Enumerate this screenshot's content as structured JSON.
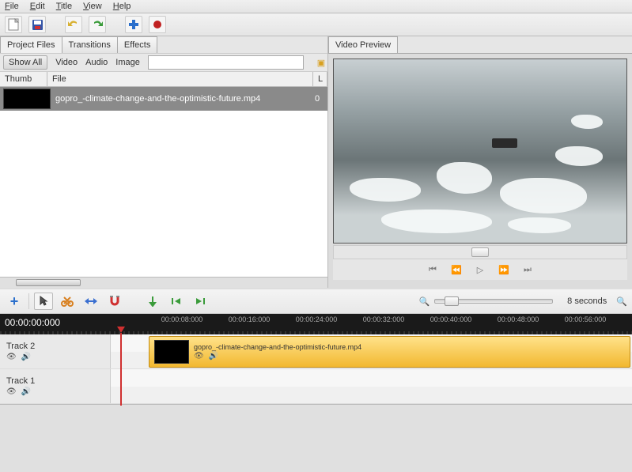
{
  "menu": {
    "file": "File",
    "edit": "Edit",
    "title": "Title",
    "view": "View",
    "help": "Help"
  },
  "toolbar_icons": {
    "new": "new",
    "save": "save",
    "undo": "undo",
    "redo": "redo",
    "add": "add",
    "record": "record"
  },
  "left_tabs": {
    "project_files": "Project Files",
    "transitions": "Transitions",
    "effects": "Effects"
  },
  "filter": {
    "show_all": "Show All",
    "video": "Video",
    "audio": "Audio",
    "image": "Image"
  },
  "file_headers": {
    "thumb": "Thumb",
    "file": "File",
    "length": "L"
  },
  "files": [
    {
      "name": "gopro_-climate-change-and-the-optimistic-future.mp4",
      "length_prefix": "0"
    }
  ],
  "right_tab": {
    "video_preview": "Video Preview"
  },
  "playback": {
    "start": "",
    "prev": "",
    "play": "",
    "next": "",
    "end": ""
  },
  "timeline_tb": {
    "add": "+",
    "select": "",
    "razor": "",
    "resize": "",
    "snap": "",
    "marker_add": "",
    "marker_prev": "",
    "marker_next": ""
  },
  "zoom": {
    "label": "8 seconds"
  },
  "timeruler": {
    "current": "00:00:00:000",
    "ticks": [
      "00:00:08:000",
      "00:00:16:000",
      "00:00:24:000",
      "00:00:32:000",
      "00:00:40:000",
      "00:00:48:000",
      "00:00:56:000"
    ]
  },
  "tracks": [
    {
      "name": "Track 2",
      "clip": {
        "name": "gopro_-climate-change-and-the-optimistic-future.mp4"
      }
    },
    {
      "name": "Track 1",
      "clip": null
    }
  ]
}
